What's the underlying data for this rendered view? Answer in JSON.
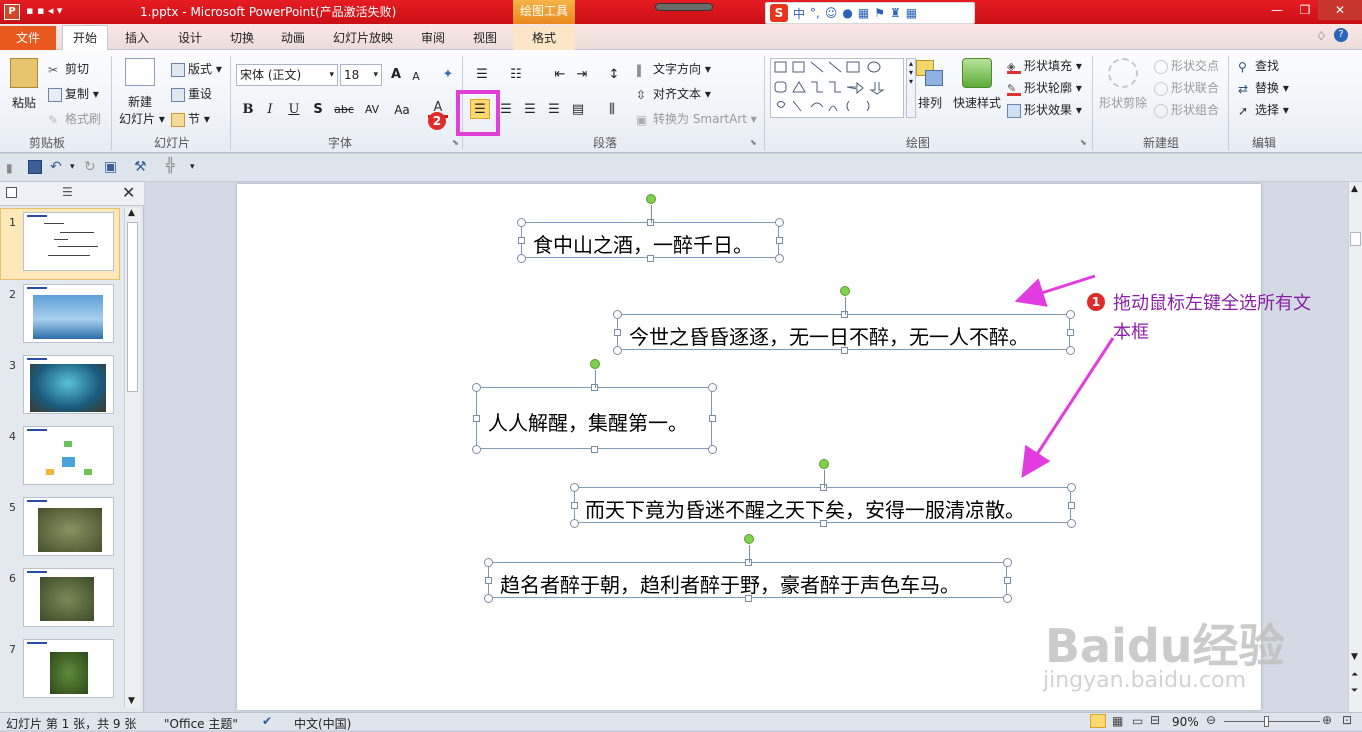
{
  "titlebar": {
    "title": "1.pptx - Microsoft PowerPoint(产品激活失败)",
    "contextual_header": "绘图工具",
    "ime": {
      "label_zh": "中",
      "punct": "°,"
    }
  },
  "tabs": [
    {
      "label": "文件"
    },
    {
      "label": "开始"
    },
    {
      "label": "插入"
    },
    {
      "label": "设计"
    },
    {
      "label": "切换"
    },
    {
      "label": "动画"
    },
    {
      "label": "幻灯片放映"
    },
    {
      "label": "审阅"
    },
    {
      "label": "视图"
    },
    {
      "label": "格式"
    }
  ],
  "ribbon": {
    "clipboard": {
      "paste": "粘贴",
      "cut": "剪切",
      "copy": "复制",
      "format_painter": "格式刷",
      "label": "剪贴板"
    },
    "slides": {
      "new_slide_1": "新建",
      "new_slide_2": "幻灯片",
      "layout": "版式",
      "reset": "重设",
      "section": "节",
      "label": "幻灯片"
    },
    "font": {
      "name": "宋体 (正文)",
      "size": "18",
      "grow": "A",
      "shrink": "A",
      "bold": "B",
      "italic": "I",
      "underline": "U",
      "shadow": "S",
      "strike": "abc",
      "spacing": "AV",
      "case": "Aa",
      "label": "字体"
    },
    "paragraph": {
      "text_direction": "文字方向",
      "align_text": "对齐文本",
      "smartart": "转换为 SmartArt",
      "label": "段落"
    },
    "drawing": {
      "arrange": "排列",
      "quick_styles": "快速样式",
      "shape_fill": "形状填充",
      "shape_outline": "形状轮廓",
      "shape_effects": "形状效果",
      "label": "绘图"
    },
    "newgroup": {
      "shape_cut": "形状剪除",
      "shape_intersect": "形状交点",
      "shape_union": "形状联合",
      "shape_combine": "形状组合",
      "label": "新建组"
    },
    "editing": {
      "find": "查找",
      "replace": "替换",
      "select": "选择",
      "label": "编辑"
    }
  },
  "slides_panel": {
    "numbers": [
      "1",
      "2",
      "3",
      "4",
      "5",
      "6",
      "7"
    ]
  },
  "slide": {
    "textboxes": [
      {
        "text": "食中山之酒，一醉千日。"
      },
      {
        "text": "今世之昏昏逐逐，无一日不醉，无一人不醉。"
      },
      {
        "text": "人人解醒，集醒第一。"
      },
      {
        "text": "而天下竟为昏迷不醒之天下矣，安得一服清凉散。"
      },
      {
        "text": "趋名者醉于朝，趋利者醉于野，豪者醉于声色车马。"
      }
    ]
  },
  "annotations": {
    "step1_badge": "1",
    "step1_line1": "拖动鼠标左键全选所有文",
    "step1_line2": "本框",
    "step2_badge": "2",
    "arrow_color": "#e23ce0",
    "highlight_color": "#e040d8"
  },
  "statusbar": {
    "slide_info": "幻灯片 第 1 张，共 9 张",
    "theme": "\"Office 主题\"",
    "language": "中文(中国)",
    "zoom": "90%"
  },
  "watermark": {
    "main": "Baidu经验",
    "sub": "jingyan.baidu.com"
  }
}
